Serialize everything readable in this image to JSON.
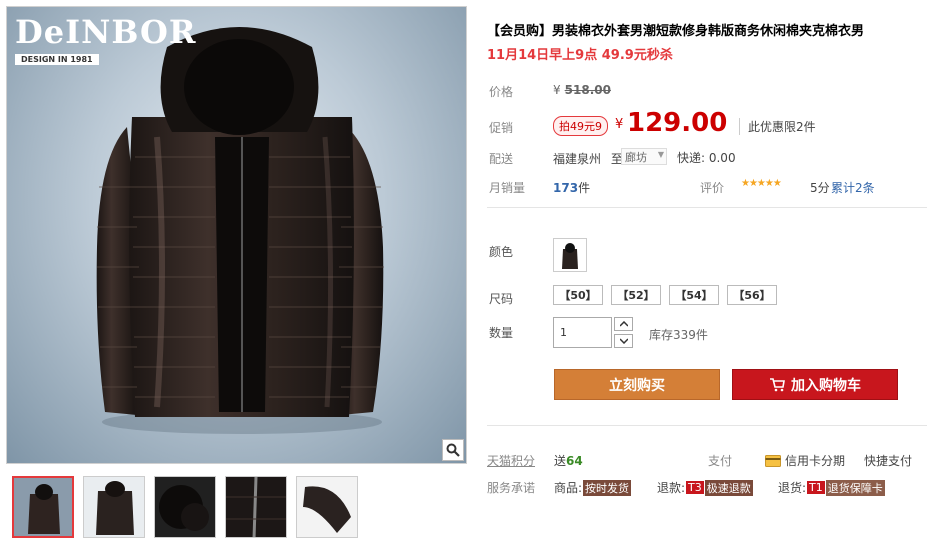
{
  "brand": {
    "name": "DeINBOR",
    "tagline": "DESIGN IN 1981"
  },
  "product": {
    "title": "【会员购】男装棉衣外套男潮短款修身韩版商务休闲棉夹克棉衣男",
    "promo_text": "11月14日早上9点 49.9元秒杀"
  },
  "price": {
    "label": "价格",
    "currency": "¥",
    "original": "518.00",
    "promo_label": "促销",
    "badge": "拍49元9",
    "current": "129.00",
    "limit": "此优惠限2件"
  },
  "shipping": {
    "label": "配送",
    "from": "福建泉州",
    "to_word": "至",
    "to_city": "廊坊",
    "express": "快递: 0.00"
  },
  "sales": {
    "label": "月销量",
    "count": "173",
    "unit": "件",
    "rating_label": "评价",
    "stars": "★★★★★",
    "score": "5分",
    "reviews": "累计2条"
  },
  "options": {
    "color_label": "颜色",
    "size_label": "尺码",
    "sizes": [
      "【50】",
      "【52】",
      "【54】",
      "【56】"
    ],
    "qty_label": "数量",
    "qty_value": "1",
    "stock": "库存339件"
  },
  "actions": {
    "buy_now": "立刻购买",
    "add_cart": "加入购物车"
  },
  "bottom": {
    "points_label": "天猫积分",
    "points_prefix": "送",
    "points_value": "64",
    "pay_label": "支付",
    "credit": "信用卡分期",
    "quick_pay": "快捷支付",
    "promise_label": "服务承诺",
    "goods_label": "商品:",
    "goods_tag": "按时发货",
    "refund_label": "退款:",
    "refund_code": "T3",
    "refund_tag": "极速退款",
    "return_label": "退货:",
    "return_code": "T1",
    "return_tag": "退货保障卡"
  },
  "colors": {
    "accent_red": "#c8161d",
    "buy_orange": "#d47f37",
    "price_red": "#cc0000"
  }
}
